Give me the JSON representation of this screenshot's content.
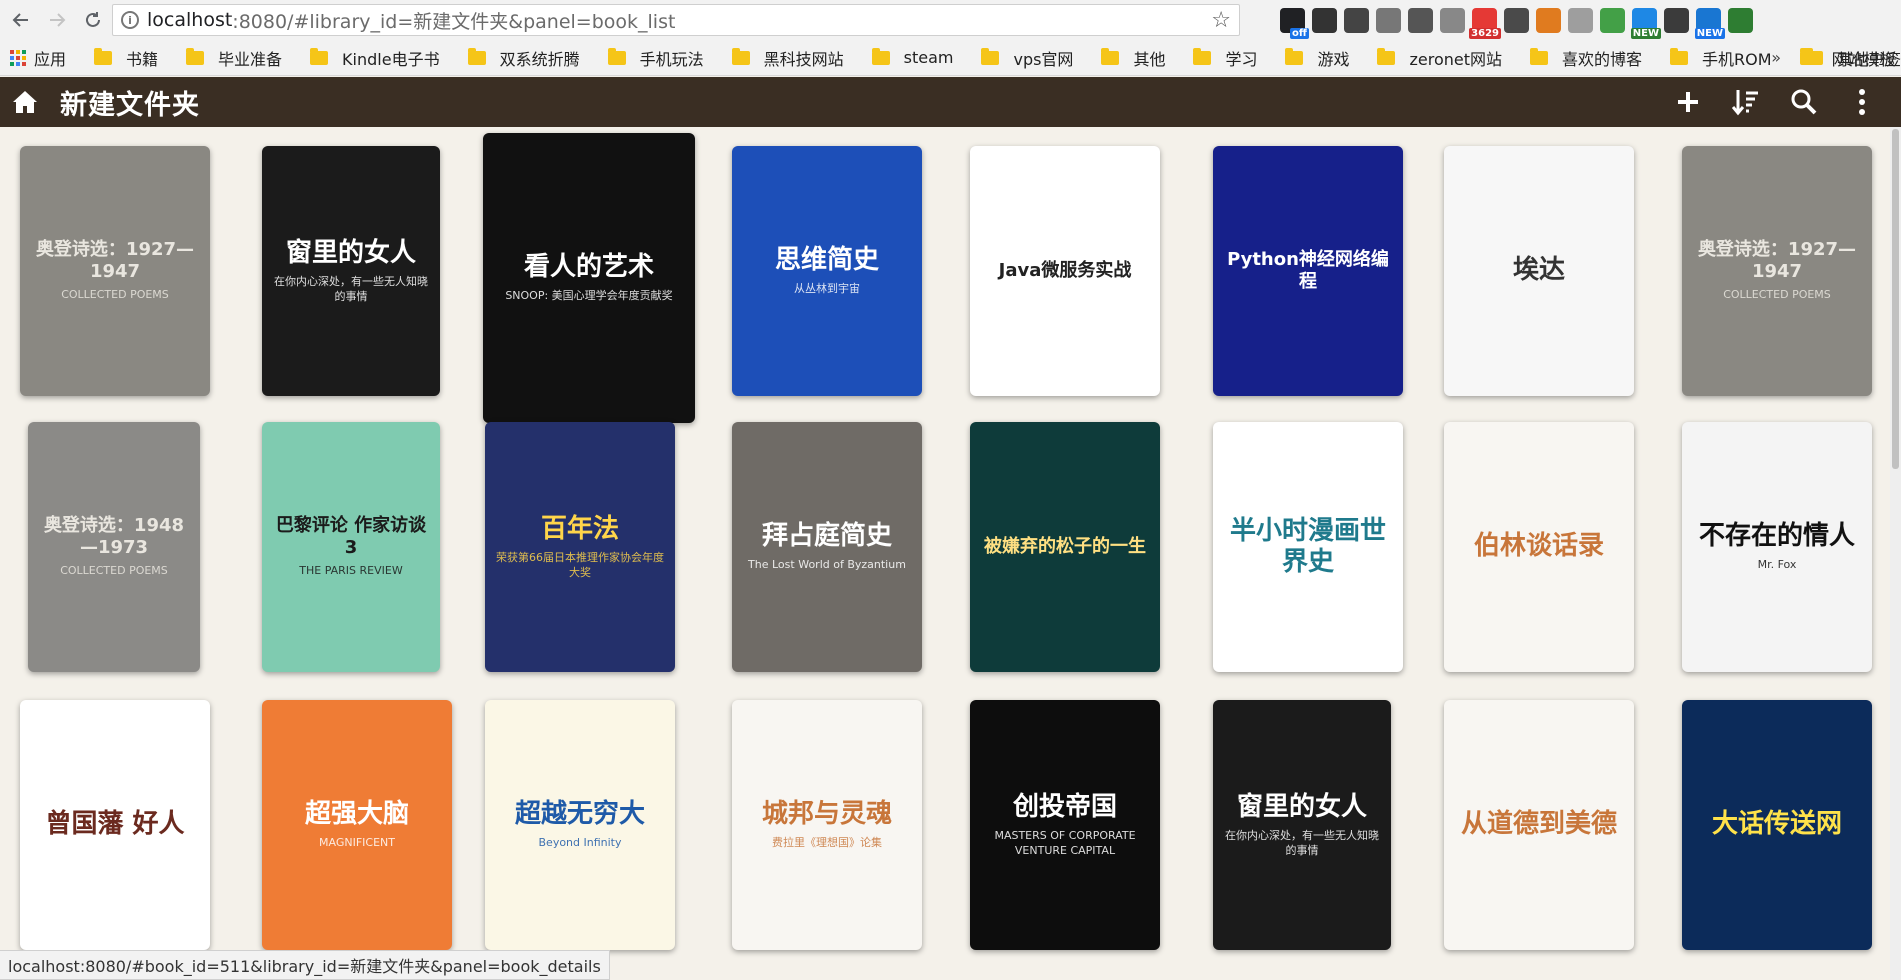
{
  "browser": {
    "url_host": "localhost",
    "url_path": ":8080/#library_id=新建文件夹&panel=book_list",
    "extensions": [
      {
        "name": "mail-ext",
        "color": "#202124",
        "badge": "off",
        "badge_color": "blue"
      },
      {
        "name": "glasses-ext",
        "color": "#333333",
        "badge": "",
        "badge_color": ""
      },
      {
        "name": "lightbulb-ext",
        "color": "#444444",
        "badge": "",
        "badge_color": ""
      },
      {
        "name": "image-ext",
        "color": "#777777",
        "badge": "",
        "badge_color": ""
      },
      {
        "name": "tree-ext",
        "color": "#555555",
        "badge": "",
        "badge_color": ""
      },
      {
        "name": "abp-ext",
        "color": "#888888",
        "badge": "",
        "badge_color": ""
      },
      {
        "name": "red-badge-ext",
        "color": "#e53935",
        "badge": "3629",
        "badge_color": "red"
      },
      {
        "name": "translate-ext",
        "color": "#4a4a4a",
        "badge": "",
        "badge_color": ""
      },
      {
        "name": "shield-ext",
        "color": "#e07b1f",
        "badge": "",
        "badge_color": ""
      },
      {
        "name": "list-ext",
        "color": "#9e9e9e",
        "badge": "",
        "badge_color": ""
      },
      {
        "name": "chrome-ext",
        "color": "#43a047",
        "badge": "",
        "badge_color": ""
      },
      {
        "name": "cloud-ext",
        "color": "#1e88e5",
        "badge": "NEW",
        "badge_color": "green"
      },
      {
        "name": "in-ext",
        "color": "#3b3b3b",
        "badge": "",
        "badge_color": ""
      },
      {
        "name": "new-ext",
        "color": "#1976d2",
        "badge": "NEW",
        "badge_color": "blue"
      },
      {
        "name": "globe-ext",
        "color": "#2e7d32",
        "badge": "",
        "badge_color": ""
      }
    ]
  },
  "bookmarks": {
    "apps_label": "应用",
    "items": [
      "书籍",
      "毕业准备",
      "Kindle电子书",
      "双系统折腾",
      "手机玩法",
      "黑科技网站",
      "steam",
      "vps官网",
      "其他",
      "学习",
      "游戏",
      "zeronet网站",
      "喜欢的博客",
      "手机ROM",
      "网站模板"
    ],
    "more": "»",
    "other_label": "其他书签"
  },
  "header": {
    "library_title": "新建文件夹"
  },
  "books": [
    {
      "title": "奥登诗选：1927—1947",
      "subtitle": "COLLECTED POEMS",
      "bg": "#8a8882",
      "fg": "#e9e6df"
    },
    {
      "title": "窗里的女人",
      "subtitle": "在你内心深处，有一些无人知晓的事情",
      "bg": "#1b1b1b",
      "fg": "#ffffff"
    },
    {
      "title": "看人的艺术",
      "subtitle": "SNOOP: 美国心理学会年度贡献奖",
      "bg": "#111111",
      "fg": "#ffffff"
    },
    {
      "title": "思维简史",
      "subtitle": "从丛林到宇宙",
      "bg": "#1d4fb8",
      "fg": "#ffffff"
    },
    {
      "title": "Java微服务实战",
      "subtitle": "",
      "bg": "#ffffff",
      "fg": "#222222"
    },
    {
      "title": "Python神经网络编程",
      "subtitle": "",
      "bg": "#16208a",
      "fg": "#ffffff"
    },
    {
      "title": "埃达",
      "subtitle": "",
      "bg": "#f7f7f7",
      "fg": "#333333"
    },
    {
      "title": "奥登诗选：1927—1947",
      "subtitle": "COLLECTED POEMS",
      "bg": "#8a8882",
      "fg": "#e9e6df"
    },
    {
      "title": "奥登诗选：1948—1973",
      "subtitle": "COLLECTED POEMS",
      "bg": "#8b8a87",
      "fg": "#e9e6df"
    },
    {
      "title": "巴黎评论 作家访谈 3",
      "subtitle": "THE PARIS REVIEW",
      "bg": "#7fcbb0",
      "fg": "#1b1b1b"
    },
    {
      "title": "百年法",
      "subtitle": "荣获第66届日本推理作家协会年度大奖",
      "bg": "#24306b",
      "fg": "#ffd54a"
    },
    {
      "title": "拜占庭简史",
      "subtitle": "The Lost World of Byzantium",
      "bg": "#6f6b66",
      "fg": "#ffffff"
    },
    {
      "title": "被嫌弃的松子的一生",
      "subtitle": "",
      "bg": "#0e3b3a",
      "fg": "#ffe082"
    },
    {
      "title": "半小时漫画世界史",
      "subtitle": "",
      "bg": "#ffffff",
      "fg": "#1f7a8c"
    },
    {
      "title": "伯林谈话录",
      "subtitle": "",
      "bg": "#f8f6f2",
      "fg": "#c8763a"
    },
    {
      "title": "不存在的情人",
      "subtitle": "Mr. Fox",
      "bg": "#f4f4f4",
      "fg": "#111111"
    },
    {
      "title": "曾国藩 好人",
      "subtitle": "",
      "bg": "#ffffff",
      "fg": "#6b2a1f"
    },
    {
      "title": "超强大脑",
      "subtitle": "MAGNIFICENT",
      "bg": "#ef7c35",
      "fg": "#ffffff"
    },
    {
      "title": "超越无穷大",
      "subtitle": "Beyond Infinity",
      "bg": "#fbf7e6",
      "fg": "#1e5aa8"
    },
    {
      "title": "城邦与灵魂",
      "subtitle": "费拉里《理想国》论集",
      "bg": "#f8f6f2",
      "fg": "#c8763a"
    },
    {
      "title": "创投帝国",
      "subtitle": "MASTERS OF CORPORATE VENTURE CAPITAL",
      "bg": "#0d0d0d",
      "fg": "#ffffff"
    },
    {
      "title": "窗里的女人",
      "subtitle": "在你内心深处，有一些无人知晓的事情",
      "bg": "#1b1b1b",
      "fg": "#ffffff"
    },
    {
      "title": "从道德到美德",
      "subtitle": "",
      "bg": "#f8f6f2",
      "fg": "#c8763a"
    },
    {
      "title": "大话传送网",
      "subtitle": "",
      "bg": "#0c2b5a",
      "fg": "#ffe24a"
    }
  ],
  "status_bar": {
    "text": "localhost:8080/#book_id=511&library_id=新建文件夹&panel=book_details"
  }
}
